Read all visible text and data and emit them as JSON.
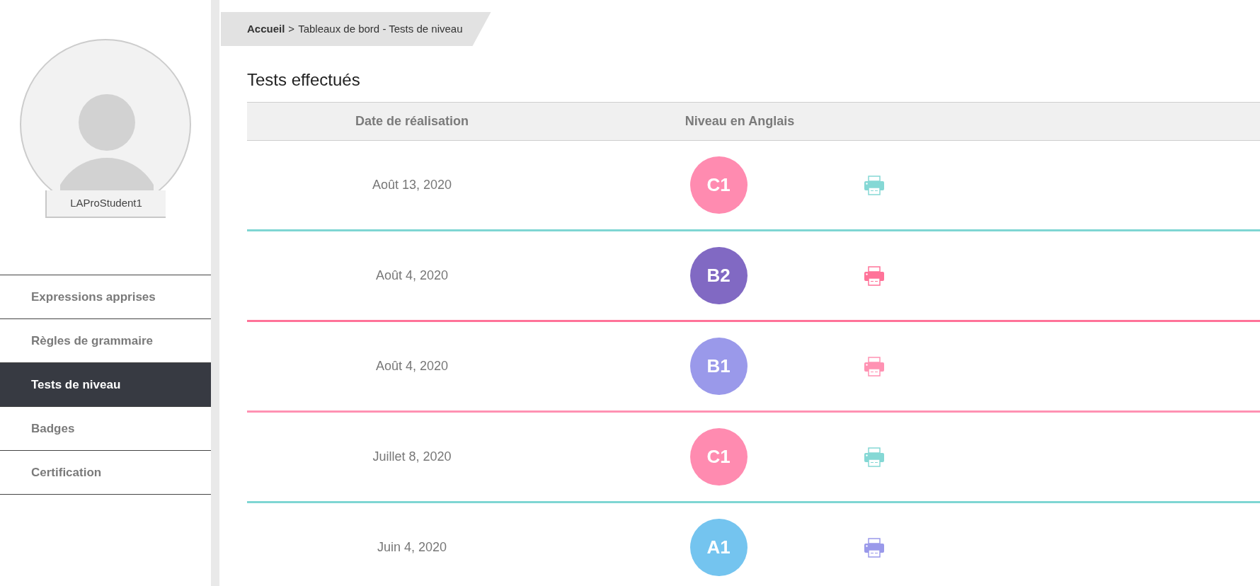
{
  "sidebar": {
    "username": "LAProStudent1",
    "items": [
      {
        "label": "Expressions apprises",
        "selected": false
      },
      {
        "label": "Règles de grammaire",
        "selected": false
      },
      {
        "label": "Tests de niveau",
        "selected": true
      },
      {
        "label": "Badges",
        "selected": false
      },
      {
        "label": "Certification",
        "selected": false
      }
    ]
  },
  "breadcrumb": {
    "home": "Accueil",
    "separator": ">",
    "current": "Tableaux de bord - Tests de niveau"
  },
  "title": "Tests effectués",
  "table": {
    "columns": [
      "Date de réalisation",
      "Niveau en Anglais"
    ],
    "rows": [
      {
        "date": "Août 13, 2020",
        "level": {
          "text": "C1",
          "color": "#ff8bb0"
        },
        "print_icon": {
          "color": "#85d8d5"
        },
        "divider": {
          "color": "#7fd6d3"
        }
      },
      {
        "date": "Août 4, 2020",
        "level": {
          "text": "B2",
          "color": "#8169c3"
        },
        "print_icon": {
          "color": "#ff7399"
        },
        "divider": {
          "color": "#ff7399"
        }
      },
      {
        "date": "Août 4, 2020",
        "level": {
          "text": "B1",
          "color": "#9a99ea"
        },
        "print_icon": {
          "color": "#ff92b3"
        },
        "divider": {
          "color": "#ff92b3"
        }
      },
      {
        "date": "Juillet 8, 2020",
        "level": {
          "text": "C1",
          "color": "#ff8bb0"
        },
        "print_icon": {
          "color": "#85d8d5"
        },
        "divider": {
          "color": "#7fd6d3"
        }
      },
      {
        "date": "Juin 4, 2020",
        "level": {
          "text": "A1",
          "color": "#74c4ef"
        },
        "print_icon": {
          "color": "#9a99ea"
        }
      }
    ]
  }
}
